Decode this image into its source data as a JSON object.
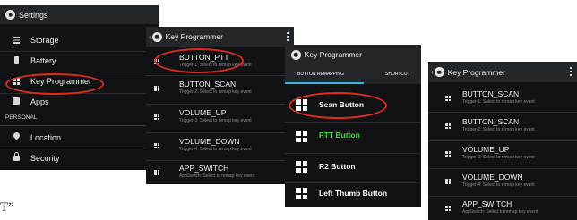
{
  "stray_text": "T”",
  "settings": {
    "title": "Settings",
    "items": [
      {
        "label": "Storage",
        "icon": "storage-icon"
      },
      {
        "label": "Battery",
        "icon": "battery-icon"
      },
      {
        "label": "Key Programmer",
        "icon": "grid-icon"
      },
      {
        "label": "Apps",
        "icon": "apps-icon"
      }
    ],
    "section": "PERSONAL",
    "personal_items": [
      {
        "label": "Location",
        "icon": "location-pin-icon"
      },
      {
        "label": "Security",
        "icon": "lock-icon"
      }
    ]
  },
  "keyprog1": {
    "title": "Key Programmer",
    "items": [
      {
        "label": "BUTTON_PTT",
        "sub": "Trigger-1: Select to remap key event"
      },
      {
        "label": "BUTTON_SCAN",
        "sub": "Trigger-2: Select to remap key event"
      },
      {
        "label": "VOLUME_UP",
        "sub": "Trigger-3: Select to remap key event"
      },
      {
        "label": "VOLUME_DOWN",
        "sub": "Trigger-4: Select to remap key event"
      },
      {
        "label": "APP_SWITCH",
        "sub": "AppSwitch: Select to remap key event"
      }
    ]
  },
  "keyprog2": {
    "title": "Key Programmer",
    "tabs": [
      "BUTTON REMAPPING",
      "SHORTCUT"
    ],
    "items": [
      {
        "label": "Scan Button",
        "color": "#ffffff"
      },
      {
        "label": "PTT Button",
        "color": "#3ddc2f"
      },
      {
        "label": "R2 Button",
        "color": "#ffffff"
      },
      {
        "label": "Left Thumb Button",
        "color": "#ffffff"
      }
    ]
  },
  "keyprog3": {
    "title": "Key Programmer",
    "items": [
      {
        "label": "BUTTON_SCAN",
        "sub": "Trigger-1: Select to remap key event"
      },
      {
        "label": "BUTTON_SCAN",
        "sub": "Trigger-2: Select to remap key event"
      },
      {
        "label": "VOLUME_UP",
        "sub": "Trigger-3: Select to remap key event"
      },
      {
        "label": "VOLUME_DOWN",
        "sub": "Trigger-4: Select to remap key event"
      },
      {
        "label": "APP_SWITCH",
        "sub": "AppSwitch: Select to remap key event"
      }
    ]
  },
  "colors": {
    "screen_bg": "#101213",
    "action_bar": "#232629",
    "highlight_oval": "#e02a1f",
    "tab_indicator": "#33b5e5",
    "ptt_green": "#3ddc2f"
  }
}
